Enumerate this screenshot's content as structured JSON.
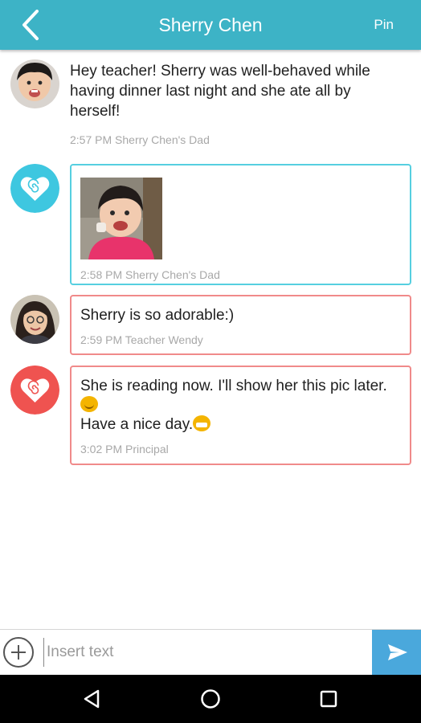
{
  "header": {
    "title": "Sherry Chen",
    "pin_label": "Pin",
    "color": "#3db3c6"
  },
  "messages": [
    {
      "avatar": "child-photo-avatar",
      "text": "Hey teacher! Sherry was well-behaved while having dinner last night and she ate all by herself!",
      "meta": "2:57 PM Sherry Chen's Dad",
      "style": "plain"
    },
    {
      "avatar": "heart-blue-avatar",
      "image": "child-photo",
      "meta": "2:58 PM Sherry Chen's Dad",
      "style": "blue"
    },
    {
      "avatar": "teacher-photo-avatar",
      "text": "Sherry is so adorable:)",
      "meta": "2:59 PM Teacher Wendy",
      "style": "red"
    },
    {
      "avatar": "heart-red-avatar",
      "text_line1": "She is reading now. I'll show her this pic later.",
      "text_line2": "Have a nice day.",
      "meta": "3:02 PM Principal",
      "style": "red"
    }
  ],
  "composer": {
    "placeholder": "Insert text",
    "send_color": "#4aa8dc"
  },
  "colors": {
    "bubble_blue": "#56cfe0",
    "bubble_red": "#f08a8a",
    "heart_blue": "#3ec7e0",
    "heart_red": "#ef5350"
  }
}
